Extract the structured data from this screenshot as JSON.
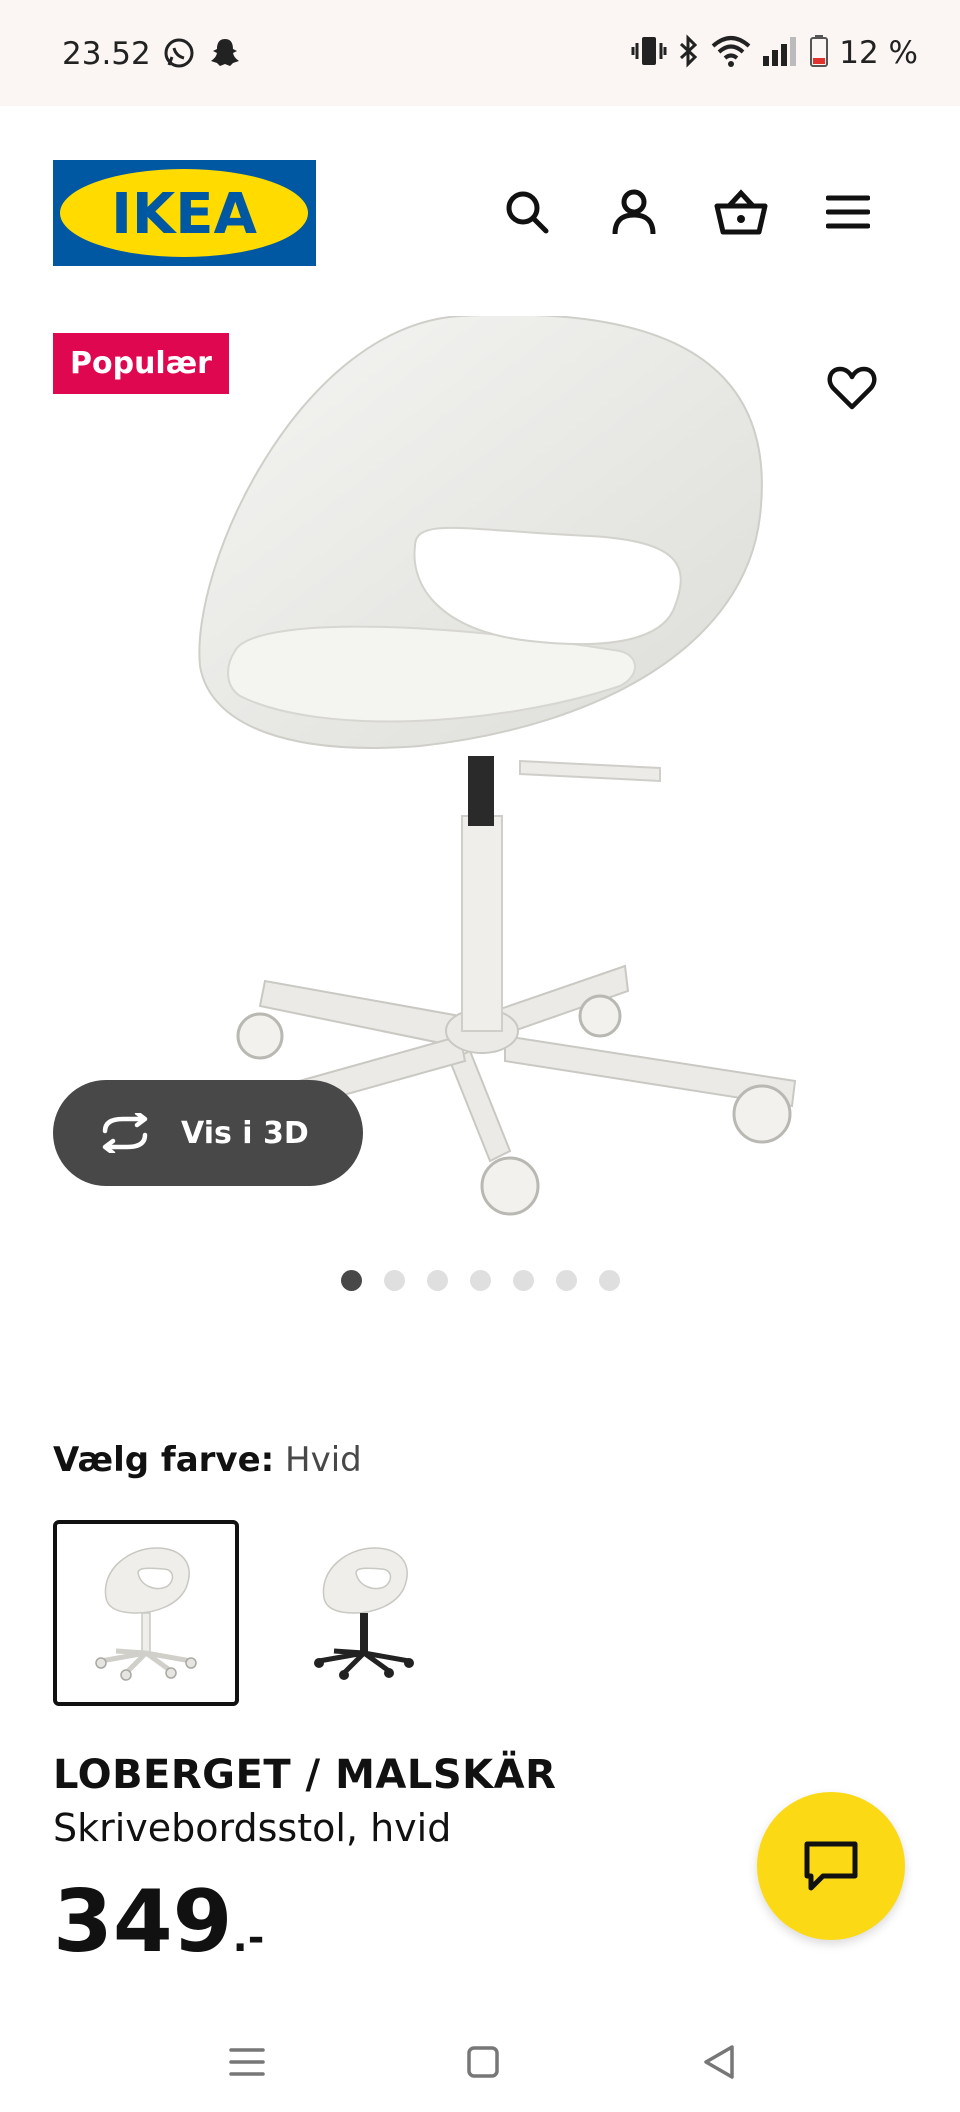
{
  "status_bar": {
    "time": "23.52",
    "battery": "12 %",
    "left_icons": [
      "whatsapp-icon",
      "snapchat-icon"
    ],
    "right_icons": [
      "vibrate-icon",
      "bluetooth-icon",
      "wifi-icon",
      "signal-icon",
      "battery-icon"
    ]
  },
  "header": {
    "logo_text": "IKEA",
    "icons": [
      "search-icon",
      "user-icon",
      "basket-icon",
      "menu-icon"
    ]
  },
  "product": {
    "badge": "Populær",
    "view_3d_label": "Vis i 3D",
    "gallery": {
      "count": 7,
      "active_index": 0
    },
    "color_label": "Vælg farve:",
    "color_value": "Hvid",
    "swatches": [
      {
        "color": "white",
        "selected": true
      },
      {
        "color": "black",
        "selected": false
      }
    ],
    "name": "LOBERGET / MALSKÄR",
    "description": "Skrivebordsstol, hvid",
    "price_integer": "349",
    "price_suffix": ".-"
  },
  "colors": {
    "ikea_blue": "#0058a3",
    "ikea_yellow": "#ffdb00",
    "badge_red": "#e00751",
    "chat_yellow": "#fbd914",
    "dark_grey": "#484848"
  },
  "nav_bar": [
    "recent-apps-icon",
    "home-icon",
    "back-icon"
  ]
}
